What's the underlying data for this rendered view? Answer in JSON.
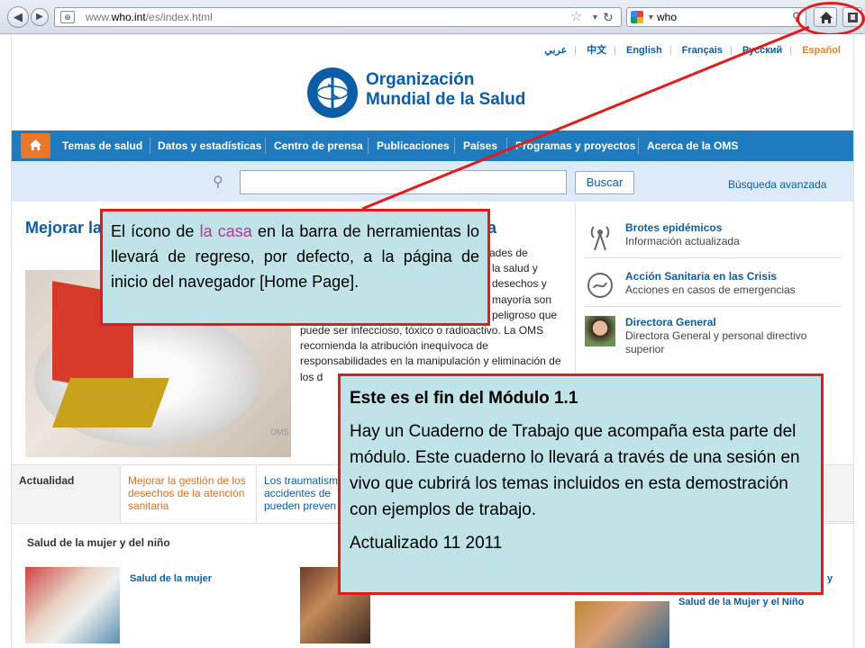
{
  "browser": {
    "url_prefix": "www.",
    "url_domain": "who.int",
    "url_path": "/es/index.html",
    "search_query": "who"
  },
  "languages": [
    "عربي",
    "中文",
    "English",
    "Français",
    "Русский",
    "Español"
  ],
  "logo": {
    "line1": "Organización",
    "line2": "Mundial de la Salud"
  },
  "nav": {
    "items": [
      "Temas de salud",
      "Datos y estadísticas",
      "Centro de prensa",
      "Publicaciones",
      "Países",
      "Programas y proyectos",
      "Acerca de la OMS"
    ]
  },
  "search": {
    "button": "Buscar",
    "advanced": "Búsqueda avanzada"
  },
  "feature": {
    "title_left": "Mejorar la",
    "title_right": "a",
    "credit": "OMS",
    "text_lines": [
      "ades de",
      "la salud y",
      "desechos y",
      "mayoría son",
      "peligroso que"
    ],
    "text_full": "puede ser infeccioso, tóxico o radioactivo. La OMS recomienda la atribución inequívoca de responsabilidades en la manipulación y eliminación de los d"
  },
  "sidebar": {
    "items": [
      {
        "title": "Brotes epidémicos",
        "subtitle": "Información actualizada",
        "icon": "radio-tower-icon"
      },
      {
        "title": "Acción Sanitaria en las Crisis",
        "subtitle": "Acciones en casos de emergencias",
        "icon": "crisis-icon"
      },
      {
        "title": "Directora General",
        "subtitle": "Directora General y personal directivo superior",
        "icon": "director-photo"
      }
    ]
  },
  "tabs": [
    "Actualidad",
    "Mejorar la gestión de los desechos de la atención sanitaria",
    "Los traumatism accidentes de pueden preven"
  ],
  "women_children": {
    "title": "Salud de la mujer y del niño",
    "link1": "Salud de la mujer",
    "link2": "Salud de la Mujer y el Niño",
    "link2_prefix": "y"
  },
  "callout_home": {
    "before": "El ícono de ",
    "highlight": "la casa",
    "after": " en la barra de herramientas lo llevará de regreso, por defecto, a la página de inicio del navegador [Home Page]."
  },
  "callout_end": {
    "heading": "Este es el fin del Módulo 1.1",
    "body": "Hay un Cuaderno de Trabajo que acompaña esta parte del módulo. Este cuaderno lo llevará a través de una sesión en vivo que cubrirá los temas incluidos en esta demostración con ejemplos de trabajo.",
    "updated": "Actualizado 11 2011"
  },
  "colors": {
    "callout_bg": "#bfe3e7",
    "callout_border": "#e31b1b",
    "who_blue": "#0b5da7",
    "nav_blue": "#1f7bbd",
    "accent_orange": "#e8762b"
  }
}
